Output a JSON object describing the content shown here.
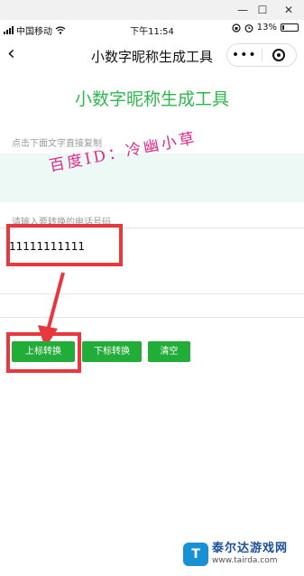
{
  "window": {
    "minimize": "—",
    "maximize": "☐",
    "close": "✕"
  },
  "status_bar": {
    "carrier": "中国移动",
    "time": "下午11:54",
    "battery_percent": "13%",
    "battery_level": 0.13
  },
  "nav": {
    "back_glyph": "‹",
    "title": "小数字昵称生成工具",
    "more_glyph": "•••"
  },
  "main": {
    "heading": "小数字昵称生成工具",
    "copy_hint": "点击下面文字直接复制",
    "watermark": "百度ID：冷幽小草",
    "input_hint": "请输入要转换的电话号码",
    "phone_value": "11111111111"
  },
  "buttons": {
    "superscript": "上标转换",
    "subscript": "下标转换",
    "clear": "清空"
  },
  "brand": {
    "mark": "T",
    "name": "泰尔达游戏网",
    "url": "www.tairda.com"
  },
  "colors": {
    "accent_green": "#22ac38",
    "heading_green": "#2db84c",
    "highlight_red": "#e8383d",
    "watermark_pink": "#e2268a",
    "copy_area_bg": "#edf9f5"
  },
  "icons": {
    "window_minimize": "minimize-icon",
    "window_maximize": "maximize-icon",
    "window_close": "close-icon",
    "back": "back-chevron-icon",
    "more": "more-dots-icon",
    "close_miniprogram": "target-circle-icon",
    "wifi": "wifi-icon",
    "alarm": "alarm-icon",
    "lock": "rotation-lock-icon",
    "battery": "battery-icon"
  }
}
